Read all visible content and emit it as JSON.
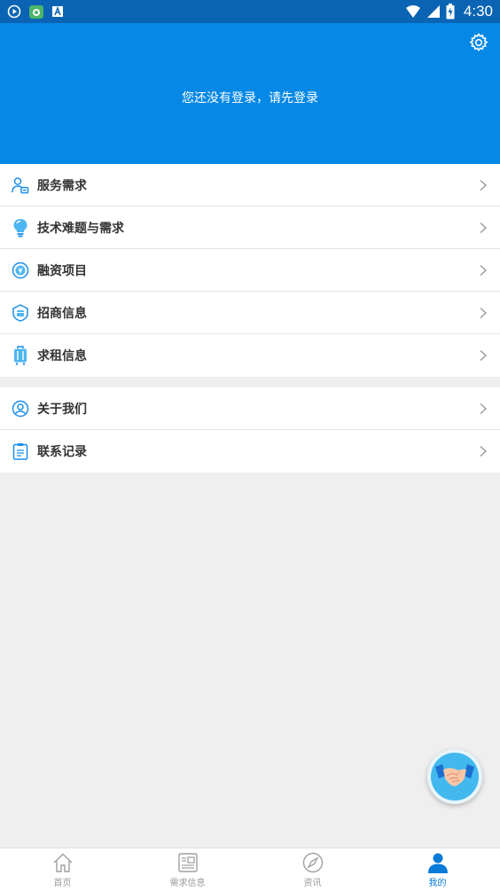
{
  "status_bar": {
    "time": "4:30",
    "left_icons": [
      "play-circle-icon",
      "camera-app-icon",
      "text-a-icon"
    ],
    "right_icons": [
      "wifi-icon",
      "cell-signal-icon",
      "battery-charging-icon"
    ]
  },
  "header": {
    "login_prompt": "您还没有登录，请先登录",
    "settings_icon": "gear-icon",
    "background": "#0588e6"
  },
  "menu_group_1": [
    {
      "label": "服务需求",
      "icon": "service-user-icon"
    },
    {
      "label": "技术难题与需求",
      "icon": "lightbulb-icon"
    },
    {
      "label": "融资项目",
      "icon": "coin-icon"
    },
    {
      "label": "招商信息",
      "icon": "shield-shop-icon"
    },
    {
      "label": "求租信息",
      "icon": "luggage-icon"
    }
  ],
  "menu_group_2": [
    {
      "label": "关于我们",
      "icon": "user-circle-icon"
    },
    {
      "label": "联系记录",
      "icon": "clipboard-icon"
    }
  ],
  "floating_button": {
    "icon": "handshake-icon"
  },
  "bottom_nav": [
    {
      "label": "首页",
      "icon": "home-icon",
      "active": false
    },
    {
      "label": "需求信息",
      "icon": "newspaper-icon",
      "active": false
    },
    {
      "label": "资讯",
      "icon": "compass-icon",
      "active": false
    },
    {
      "label": "我的",
      "icon": "person-icon",
      "active": true
    }
  ],
  "colors": {
    "accent": "#0588e6",
    "status_bar": "#0a64b3",
    "nav_active": "#0a7bd8",
    "icon_blue": "#1c8ee8"
  }
}
